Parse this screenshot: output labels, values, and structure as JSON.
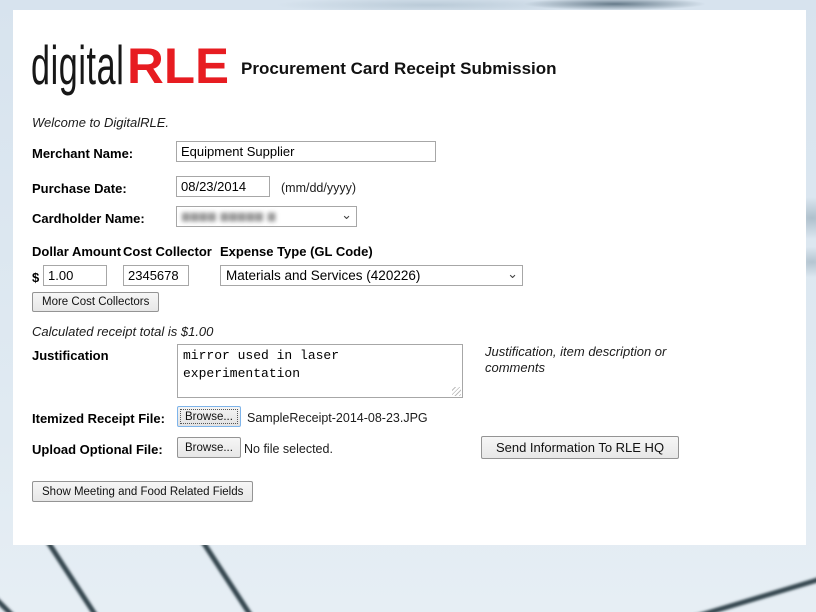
{
  "icons": {
    "chevron_down": "⌄"
  },
  "colors": {
    "logo_red": "#e71c21",
    "page_bg": "#d9e5ef",
    "focus_border": "#7eb4ea"
  },
  "header": {
    "logo_black": "digital",
    "logo_red": "RLE",
    "title": "Procurement Card Receipt Submission"
  },
  "intro": {
    "welcome": "Welcome to DigitalRLE."
  },
  "form": {
    "merchant": {
      "label": "Merchant Name:",
      "value": "Equipment Supplier"
    },
    "purchase_date": {
      "label": "Purchase Date:",
      "value": "08/23/2014",
      "format_hint": "(mm/dd/yyyy)"
    },
    "cardholder": {
      "label": "Cardholder Name:",
      "redacted_value": "▆▆▆▆ ▆▆▆▆▆ ▆"
    },
    "line_item": {
      "col_dollar": "Dollar Amount",
      "col_cost": "Cost Collector",
      "col_expense": "Expense Type (GL Code)",
      "currency_prefix": "$",
      "dollar_amount": "1.00",
      "cost_collector": "2345678",
      "expense_type": "Materials and Services (420226)"
    },
    "more_cost_collectors_button": "More Cost Collectors",
    "calculated_total": "Calculated receipt total is $1.00",
    "justification": {
      "label": "Justification",
      "value": "mirror used in laser\nexperimentation",
      "note": "Justification, item description or comments"
    },
    "itemized_receipt": {
      "label": "Itemized Receipt File:",
      "browse_button": "Browse...",
      "file_name": "SampleReceipt-2014-08-23.JPG"
    },
    "optional_file": {
      "label": "Upload Optional File:",
      "browse_button": "Browse...",
      "status": "No file selected."
    },
    "send_button": "Send Information To RLE HQ",
    "show_meeting_button": "Show Meeting and Food Related Fields"
  }
}
